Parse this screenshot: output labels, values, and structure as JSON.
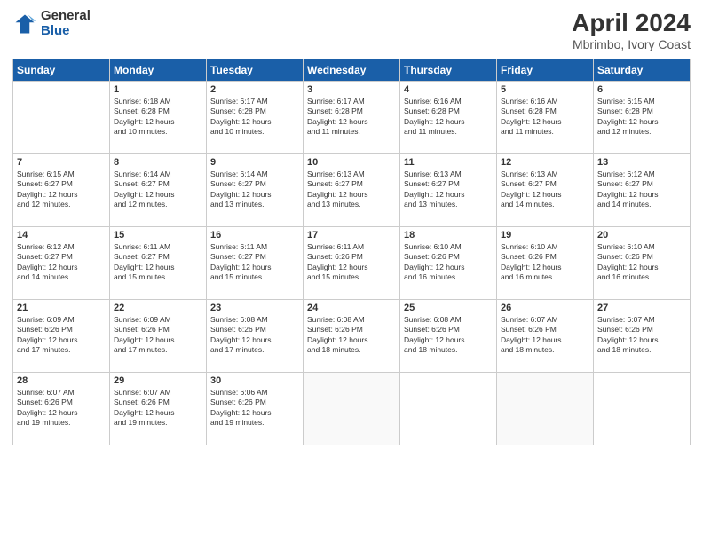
{
  "header": {
    "logo": {
      "general": "General",
      "blue": "Blue"
    },
    "title": "April 2024",
    "subtitle": "Mbrimbo, Ivory Coast"
  },
  "weekdays": [
    "Sunday",
    "Monday",
    "Tuesday",
    "Wednesday",
    "Thursday",
    "Friday",
    "Saturday"
  ],
  "weeks": [
    [
      {
        "day": "",
        "info": ""
      },
      {
        "day": "1",
        "info": "Sunrise: 6:18 AM\nSunset: 6:28 PM\nDaylight: 12 hours\nand 10 minutes."
      },
      {
        "day": "2",
        "info": "Sunrise: 6:17 AM\nSunset: 6:28 PM\nDaylight: 12 hours\nand 10 minutes."
      },
      {
        "day": "3",
        "info": "Sunrise: 6:17 AM\nSunset: 6:28 PM\nDaylight: 12 hours\nand 11 minutes."
      },
      {
        "day": "4",
        "info": "Sunrise: 6:16 AM\nSunset: 6:28 PM\nDaylight: 12 hours\nand 11 minutes."
      },
      {
        "day": "5",
        "info": "Sunrise: 6:16 AM\nSunset: 6:28 PM\nDaylight: 12 hours\nand 11 minutes."
      },
      {
        "day": "6",
        "info": "Sunrise: 6:15 AM\nSunset: 6:28 PM\nDaylight: 12 hours\nand 12 minutes."
      }
    ],
    [
      {
        "day": "7",
        "info": "Sunrise: 6:15 AM\nSunset: 6:27 PM\nDaylight: 12 hours\nand 12 minutes."
      },
      {
        "day": "8",
        "info": "Sunrise: 6:14 AM\nSunset: 6:27 PM\nDaylight: 12 hours\nand 12 minutes."
      },
      {
        "day": "9",
        "info": "Sunrise: 6:14 AM\nSunset: 6:27 PM\nDaylight: 12 hours\nand 13 minutes."
      },
      {
        "day": "10",
        "info": "Sunrise: 6:13 AM\nSunset: 6:27 PM\nDaylight: 12 hours\nand 13 minutes."
      },
      {
        "day": "11",
        "info": "Sunrise: 6:13 AM\nSunset: 6:27 PM\nDaylight: 12 hours\nand 13 minutes."
      },
      {
        "day": "12",
        "info": "Sunrise: 6:13 AM\nSunset: 6:27 PM\nDaylight: 12 hours\nand 14 minutes."
      },
      {
        "day": "13",
        "info": "Sunrise: 6:12 AM\nSunset: 6:27 PM\nDaylight: 12 hours\nand 14 minutes."
      }
    ],
    [
      {
        "day": "14",
        "info": "Sunrise: 6:12 AM\nSunset: 6:27 PM\nDaylight: 12 hours\nand 14 minutes."
      },
      {
        "day": "15",
        "info": "Sunrise: 6:11 AM\nSunset: 6:27 PM\nDaylight: 12 hours\nand 15 minutes."
      },
      {
        "day": "16",
        "info": "Sunrise: 6:11 AM\nSunset: 6:27 PM\nDaylight: 12 hours\nand 15 minutes."
      },
      {
        "day": "17",
        "info": "Sunrise: 6:11 AM\nSunset: 6:26 PM\nDaylight: 12 hours\nand 15 minutes."
      },
      {
        "day": "18",
        "info": "Sunrise: 6:10 AM\nSunset: 6:26 PM\nDaylight: 12 hours\nand 16 minutes."
      },
      {
        "day": "19",
        "info": "Sunrise: 6:10 AM\nSunset: 6:26 PM\nDaylight: 12 hours\nand 16 minutes."
      },
      {
        "day": "20",
        "info": "Sunrise: 6:10 AM\nSunset: 6:26 PM\nDaylight: 12 hours\nand 16 minutes."
      }
    ],
    [
      {
        "day": "21",
        "info": "Sunrise: 6:09 AM\nSunset: 6:26 PM\nDaylight: 12 hours\nand 17 minutes."
      },
      {
        "day": "22",
        "info": "Sunrise: 6:09 AM\nSunset: 6:26 PM\nDaylight: 12 hours\nand 17 minutes."
      },
      {
        "day": "23",
        "info": "Sunrise: 6:08 AM\nSunset: 6:26 PM\nDaylight: 12 hours\nand 17 minutes."
      },
      {
        "day": "24",
        "info": "Sunrise: 6:08 AM\nSunset: 6:26 PM\nDaylight: 12 hours\nand 18 minutes."
      },
      {
        "day": "25",
        "info": "Sunrise: 6:08 AM\nSunset: 6:26 PM\nDaylight: 12 hours\nand 18 minutes."
      },
      {
        "day": "26",
        "info": "Sunrise: 6:07 AM\nSunset: 6:26 PM\nDaylight: 12 hours\nand 18 minutes."
      },
      {
        "day": "27",
        "info": "Sunrise: 6:07 AM\nSunset: 6:26 PM\nDaylight: 12 hours\nand 18 minutes."
      }
    ],
    [
      {
        "day": "28",
        "info": "Sunrise: 6:07 AM\nSunset: 6:26 PM\nDaylight: 12 hours\nand 19 minutes."
      },
      {
        "day": "29",
        "info": "Sunrise: 6:07 AM\nSunset: 6:26 PM\nDaylight: 12 hours\nand 19 minutes."
      },
      {
        "day": "30",
        "info": "Sunrise: 6:06 AM\nSunset: 6:26 PM\nDaylight: 12 hours\nand 19 minutes."
      },
      {
        "day": "",
        "info": ""
      },
      {
        "day": "",
        "info": ""
      },
      {
        "day": "",
        "info": ""
      },
      {
        "day": "",
        "info": ""
      }
    ]
  ]
}
